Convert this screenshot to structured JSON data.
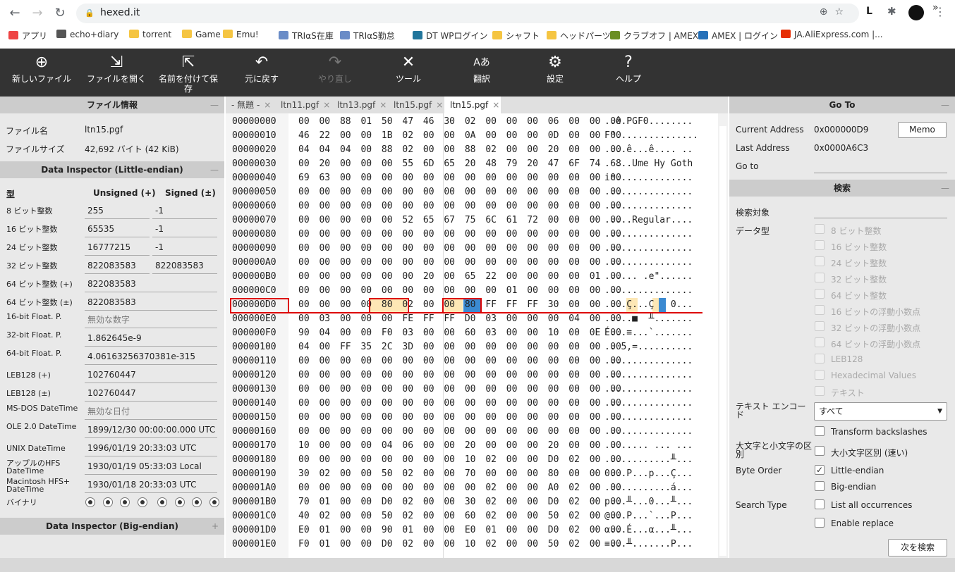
{
  "browser": {
    "url": "hexed.it",
    "lock_icon": "lock-icon"
  },
  "bookmarks": [
    {
      "label": "アプリ",
      "color": "#e44"
    },
    {
      "label": "echo+diary",
      "color": "#555"
    },
    {
      "label": "torrent",
      "color": "#f5c542"
    },
    {
      "label": "Game",
      "color": "#f5c542"
    },
    {
      "label": "Emu!",
      "color": "#f5c542"
    },
    {
      "label": "TRIαS在庫",
      "color": "#6a8cc7"
    },
    {
      "label": "TRIαS勤怠",
      "color": "#6a8cc7"
    },
    {
      "label": "DT WPログイン",
      "color": "#21759b"
    },
    {
      "label": "シャフト",
      "color": "#f5c542"
    },
    {
      "label": "ヘッドパーツ",
      "color": "#f5c542"
    },
    {
      "label": "クラブオフ | AMEX",
      "color": "#6b8e23"
    },
    {
      "label": "AMEX | ログイン",
      "color": "#2671b9"
    },
    {
      "label": "JA.AliExpress.com |...",
      "color": "#e62e04"
    }
  ],
  "toolbar": [
    {
      "label": "新しいファイル",
      "icon": "new-file-icon",
      "glyph": "⊕",
      "disabled": false
    },
    {
      "label": "ファイルを開く",
      "icon": "open-file-icon",
      "glyph": "⇲",
      "disabled": false
    },
    {
      "label": "名前を付けて保存",
      "icon": "save-as-icon",
      "glyph": "⇱",
      "disabled": false
    },
    {
      "label": "元に戻す",
      "icon": "undo-icon",
      "glyph": "↶",
      "disabled": false
    },
    {
      "label": "やり直し",
      "icon": "redo-icon",
      "glyph": "↷",
      "disabled": true
    },
    {
      "label": "ツール",
      "icon": "tools-icon",
      "glyph": "✕",
      "disabled": false
    },
    {
      "label": "翻訳",
      "icon": "translate-icon",
      "glyph": "Aあ",
      "disabled": false
    },
    {
      "label": "設定",
      "icon": "gear-icon",
      "glyph": "⚙",
      "disabled": false
    },
    {
      "label": "ヘルプ",
      "icon": "help-icon",
      "glyph": "?",
      "disabled": false
    }
  ],
  "file_info": {
    "title": "ファイル情報",
    "toggle": "—",
    "name_label": "ファイル名",
    "name_value": "ltn15.pgf",
    "size_label": "ファイルサイズ",
    "size_value": "42,692 バイト (42 KiB)"
  },
  "inspector_le": {
    "title": "Data Inspector (Little-endian)",
    "toggle": "—",
    "col_type": "型",
    "col_unsigned": "Unsigned (+)",
    "col_signed": "Signed (±)",
    "rows": [
      {
        "label": "8 ビット整数",
        "u": "255",
        "s": "-1"
      },
      {
        "label": "16 ビット整数",
        "u": "65535",
        "s": "-1"
      },
      {
        "label": "24 ビット整数",
        "u": "16777215",
        "s": "-1"
      },
      {
        "label": "32 ビット整数",
        "u": "822083583",
        "s": "822083583"
      },
      {
        "label": "64 ビット整数 (+)",
        "w": "822083583"
      },
      {
        "label": "64 ビット整数 (±)",
        "w": "822083583"
      },
      {
        "label": "16-bit Float. P.",
        "w": "無効な数字",
        "gray": true
      },
      {
        "label": "32-bit Float. P.",
        "w": "1.862645e-9"
      },
      {
        "label": "64-bit Float. P.",
        "w": "4.06163256370381e-315"
      },
      {
        "label": "LEB128 (+)",
        "w": "102760447"
      },
      {
        "label": "LEB128 (±)",
        "w": "102760447"
      },
      {
        "label": "MS-DOS DateTime",
        "w": "無効な日付",
        "gray": true
      },
      {
        "label": "OLE 2.0 DateTime",
        "w": "1899/12/30 00:00:00.000 UTC"
      },
      {
        "label": "UNIX DateTime",
        "w": "1996/01/19 20:33:03 UTC"
      },
      {
        "label": "アップルのHFS DateTime",
        "w": "1930/01/19 05:33:03 Local"
      },
      {
        "label": "Macintosh HFS+ DateTime",
        "w": "1930/01/18 20:33:03 UTC"
      },
      {
        "label": "バイナリ",
        "radios": 8
      }
    ]
  },
  "inspector_be": {
    "title": "Data Inspector (Big-endian)",
    "toggle": "+"
  },
  "tabs": [
    {
      "label": "- 無題 -",
      "close": "×",
      "active": false
    },
    {
      "label": "ltn11.pgf",
      "close": "×",
      "active": false
    },
    {
      "label": "ltn13.pgf",
      "close": "×",
      "active": false
    },
    {
      "label": "ltn15.pgf",
      "close": "×",
      "active": false
    },
    {
      "label": "ltn15.pgf",
      "close": "×",
      "active": true
    }
  ],
  "hex_rows": [
    {
      "a": "00000000",
      "b": "00 00 88 01 50 47 46 30 02 00 00 00 06 00 00 00",
      "t": "..ê.PGF0........"
    },
    {
      "a": "00000010",
      "b": "46 22 00 00 1B 02 00 00 0A 00 00 00 0D 00 00 00",
      "t": "F\"..............."
    },
    {
      "a": "00000020",
      "b": "04 04 04 00 88 02 00 00 88 02 00 00 20 00 00 00",
      "t": "....ê...ê.... .."
    },
    {
      "a": "00000030",
      "b": "00 20 00 00 00 55 6D 65 20 48 79 20 47 6F 74 68",
      "t": ". ...Ume Hy Goth"
    },
    {
      "a": "00000040",
      "b": "69 63 00 00 00 00 00 00 00 00 00 00 00 00 00 00",
      "t": "ic.............."
    },
    {
      "a": "00000050",
      "b": "00 00 00 00 00 00 00 00 00 00 00 00 00 00 00 00",
      "t": "................"
    },
    {
      "a": "00000060",
      "b": "00 00 00 00 00 00 00 00 00 00 00 00 00 00 00 00",
      "t": "................"
    },
    {
      "a": "00000070",
      "b": "00 00 00 00 00 52 65 67 75 6C 61 72 00 00 00 00",
      "t": ".....Regular...."
    },
    {
      "a": "00000080",
      "b": "00 00 00 00 00 00 00 00 00 00 00 00 00 00 00 00",
      "t": "................"
    },
    {
      "a": "00000090",
      "b": "00 00 00 00 00 00 00 00 00 00 00 00 00 00 00 00",
      "t": "................"
    },
    {
      "a": "000000A0",
      "b": "00 00 00 00 00 00 00 00 00 00 00 00 00 00 00 00",
      "t": "................"
    },
    {
      "a": "000000B0",
      "b": "00 00 00 00 00 00 20 00 65 22 00 00 00 00 01 00",
      "t": "...... .e\"......"
    },
    {
      "a": "000000C0",
      "b": "00 00 00 00 00 00 00 00 00 00 01 00 00 00 00 00",
      "t": "................"
    },
    {
      "a": "000000D0",
      "b": "00 00 00 00 80 02 00 00 80 FF FF FF 30 00 00 00",
      "t": "....Ç...Ç   0..."
    },
    {
      "a": "000000E0",
      "b": "00 03 00 00 00 FE FF FF D0 03 00 00 00 04 00 00",
      "t": ".....■  ╨......."
    },
    {
      "a": "000000F0",
      "b": "90 04 00 00 F0 03 00 00 60 03 00 00 10 00 0E 00",
      "t": "É...≡...`......."
    },
    {
      "a": "00000100",
      "b": "04 00 FF 35 2C 3D 00 00 00 00 00 00 00 00 00 00",
      "t": ".. 5,=.........."
    },
    {
      "a": "00000110",
      "b": "00 00 00 00 00 00 00 00 00 00 00 00 00 00 00 00",
      "t": "................"
    },
    {
      "a": "00000120",
      "b": "00 00 00 00 00 00 00 00 00 00 00 00 00 00 00 00",
      "t": "................"
    },
    {
      "a": "00000130",
      "b": "00 00 00 00 00 00 00 00 00 00 00 00 00 00 00 00",
      "t": "................"
    },
    {
      "a": "00000140",
      "b": "00 00 00 00 00 00 00 00 00 00 00 00 00 00 00 00",
      "t": "................"
    },
    {
      "a": "00000150",
      "b": "00 00 00 00 00 00 00 00 00 00 00 00 00 00 00 00",
      "t": "................"
    },
    {
      "a": "00000160",
      "b": "00 00 00 00 00 00 00 00 00 00 00 00 00 00 00 00",
      "t": "................"
    },
    {
      "a": "00000170",
      "b": "10 00 00 00 04 06 00 00 20 00 00 00 20 00 00 00",
      "t": "........ ... ..."
    },
    {
      "a": "00000180",
      "b": "00 00 00 00 00 00 00 00 10 02 00 00 D0 02 00 00",
      "t": "............╨..."
    },
    {
      "a": "00000190",
      "b": "30 02 00 00 50 02 00 00 70 00 00 00 80 00 00 00",
      "t": "0...P...p...Ç..."
    },
    {
      "a": "000001A0",
      "b": "00 00 00 00 00 00 00 00 00 02 00 00 A0 02 00 00",
      "t": "............á..."
    },
    {
      "a": "000001B0",
      "b": "70 01 00 00 D0 02 00 00 30 02 00 00 D0 02 00 00",
      "t": "p...╨...0...╨..."
    },
    {
      "a": "000001C0",
      "b": "40 02 00 00 50 02 00 00 60 02 00 00 50 02 00 00",
      "t": "@...P...`...P..."
    },
    {
      "a": "000001D0",
      "b": "E0 01 00 00 90 01 00 00 E0 01 00 00 D0 02 00 00",
      "t": "α...É...α...╨..."
    },
    {
      "a": "000001E0",
      "b": "F0 01 00 00 D0 02 00 00 10 02 00 00 50 02 00 00",
      "t": "≡...╨.......P..."
    }
  ],
  "goto": {
    "title": "Go To",
    "toggle": "—",
    "current_label": "Current Address",
    "current_value": "0x000000D9",
    "memo": "Memo",
    "last_label": "Last Address",
    "last_value": "0x0000A6C3",
    "goto_label": "Go to"
  },
  "search": {
    "title": "検索",
    "toggle": "—",
    "target_label": "検索対象",
    "type_label": "データ型",
    "types": [
      "8 ビット整数",
      "16 ビット整数",
      "24 ビット整数",
      "32 ビット整数",
      "64 ビット整数",
      "16 ビットの浮動小数点",
      "32 ビットの浮動小数点",
      "64 ビットの浮動小数点",
      "LEB128",
      "Hexadecimal Values",
      "テキスト"
    ],
    "encoding_label": "テキスト エンコード",
    "encoding_value": "すべて",
    "transform": "Transform backslashes",
    "case_label": "大文字と小文字の区別",
    "case_option": "大小文字区別 (速い)",
    "byteorder_label": "Byte Order",
    "little": "Little-endian",
    "big": "Big-endian",
    "searchtype_label": "Search Type",
    "all": "List all occurrences",
    "replace": "Enable replace",
    "next": "次を検索"
  }
}
